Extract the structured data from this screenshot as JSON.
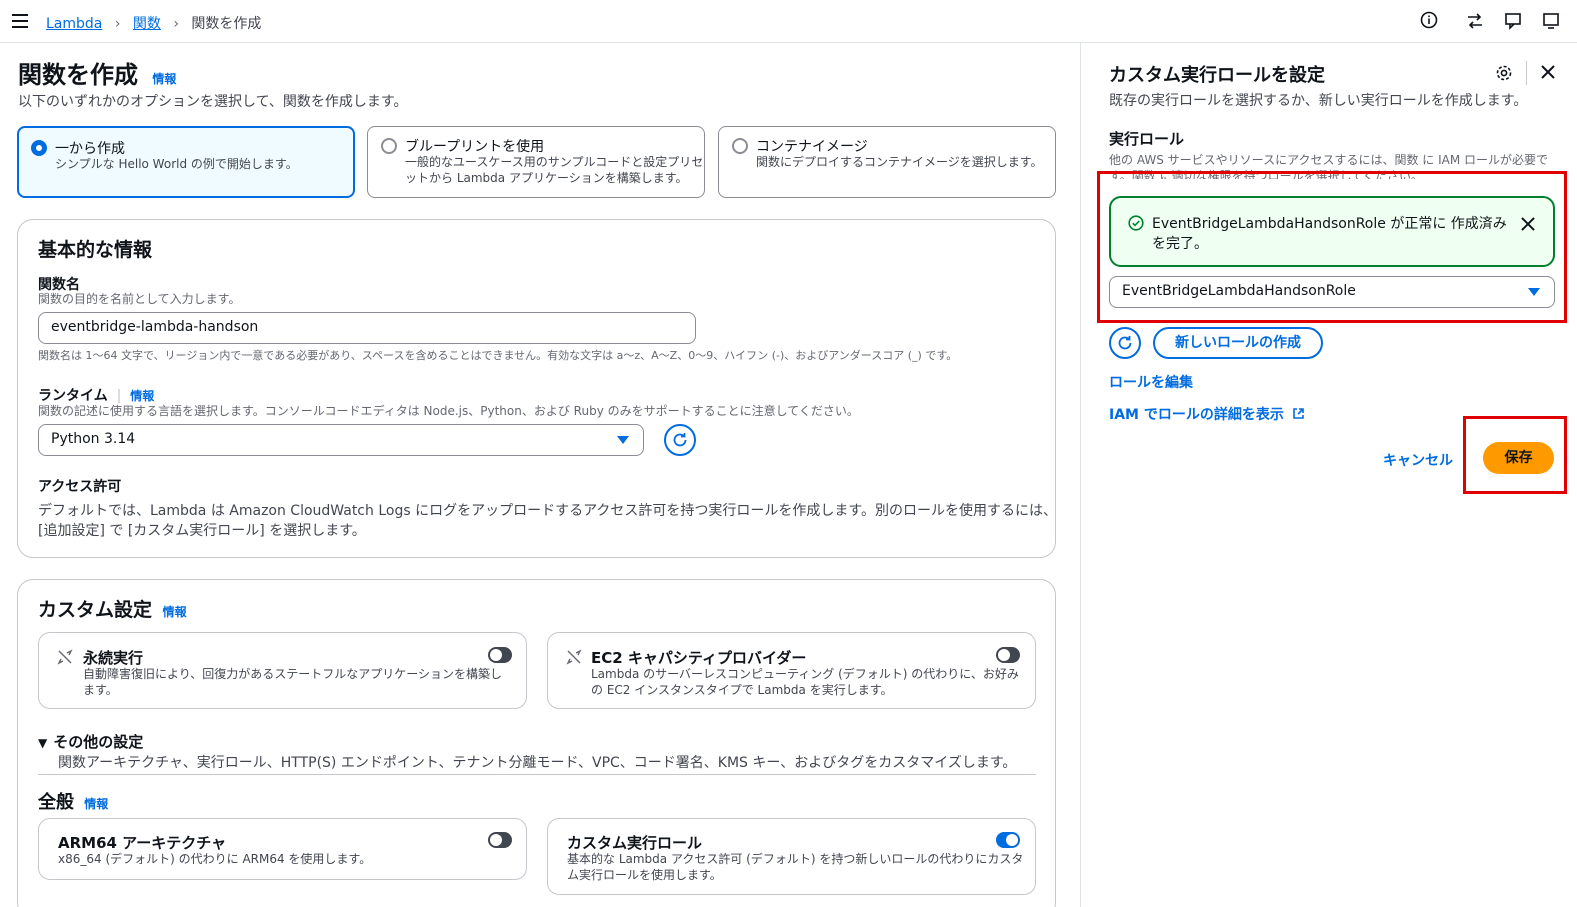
{
  "breadcrumb": {
    "items": [
      "Lambda",
      "関数",
      "関数を作成"
    ]
  },
  "page": {
    "title": "関数を作成",
    "info": "情報",
    "subtitle": "以下のいずれかのオプションを選択して、関数を作成します。"
  },
  "creation_options": [
    {
      "title": "一から作成",
      "desc": "シンプルな Hello World の例で開始します。",
      "selected": true
    },
    {
      "title": "ブループリントを使用",
      "desc1": "一般的なユースケース用のサンプルコードと設定プリセ",
      "desc2": "ットから Lambda アプリケーションを構築します。",
      "selected": false
    },
    {
      "title": "コンテナイメージ",
      "desc": "関数にデプロイするコンテナイメージを選択します。",
      "selected": false
    }
  ],
  "basic": {
    "heading": "基本的な情報",
    "fn_label": "関数名",
    "fn_desc": "関数の目的を名前として入力します。",
    "fn_value": "eventbridge-lambda-handson",
    "fn_constraint": "関数名は 1〜64 文字で、リージョン内で一意である必要があり、スペースを含めることはできません。有効な文字は a〜z、A〜Z、0〜9、ハイフン (-)、およびアンダースコア (_) です。",
    "runtime_label": "ランタイム",
    "runtime_info": "情報",
    "runtime_desc": "関数の記述に使用する言語を選択します。コンソールコードエディタは Node.js、Python、および Ruby のみをサポートすることに注意してください。",
    "runtime_value": "Python 3.14",
    "access_label": "アクセス許可",
    "access_desc1": "デフォルトでは、Lambda は Amazon CloudWatch Logs にログをアップロードするアクセス許可を持つ実行ロールを作成します。別のロールを使用するには、",
    "access_desc2": "[追加設定] で [カスタム実行ロール] を選択します。"
  },
  "custom": {
    "heading": "カスタム設定",
    "info": "情報",
    "durable": {
      "title": "永続実行",
      "desc1": "自動障害復旧により、回復力があるステートフルなアプリケーションを構築し",
      "desc2": "ます。"
    },
    "ec2": {
      "title": "EC2 キャパシティプロバイダー",
      "desc1": "Lambda のサーバーレスコンピューティング (デフォルト) の代わりに、お好み",
      "desc2": "の EC2 インスタンスタイプで Lambda を実行します。"
    },
    "other_title": "その他の設定",
    "other_desc": "関数アーキテクチャ、実行ロール、HTTP(S) エンドポイント、テナント分離モード、VPC、コード署名、KMS キー、およびタグをカスタマイズします。",
    "general_heading": "全般",
    "general_info": "情報",
    "arm": {
      "title": "ARM64 アーキテクチャ",
      "desc": "x86_64 (デフォルト) の代わりに ARM64 を使用します。"
    },
    "role": {
      "title": "カスタム実行ロール",
      "desc1": "基本的な Lambda アクセス許可 (デフォルト) を持つ新しいロールの代わりにカスタ",
      "desc2": "ム実行ロールを使用します。"
    }
  },
  "panel": {
    "title": "カスタム実行ロールを設定",
    "subtitle": "既存の実行ロールを選択するか、新しい実行ロールを作成します。",
    "role_label": "実行ロール",
    "role_desc1": "他の AWS サービスやリソースにアクセスするには、関数 に IAM ロールが必要で",
    "role_desc2": "す。関数 に適切な権限を持つロールを選択してください。",
    "flash1": "EventBridgeLambdaHandsonRole が正常に 作成済み",
    "flash2": "を完了。",
    "role_value": "EventBridgeLambdaHandsonRole",
    "new_role": "新しいロールの作成",
    "edit_role": "ロールを編集",
    "iam_link": "IAM でロールの詳細を表示",
    "cancel": "キャンセル",
    "save": "保存"
  },
  "colors": {
    "accent": "#006ce0",
    "success": "#00802f",
    "highlight": "#e00000",
    "primary": "#ff9900"
  }
}
